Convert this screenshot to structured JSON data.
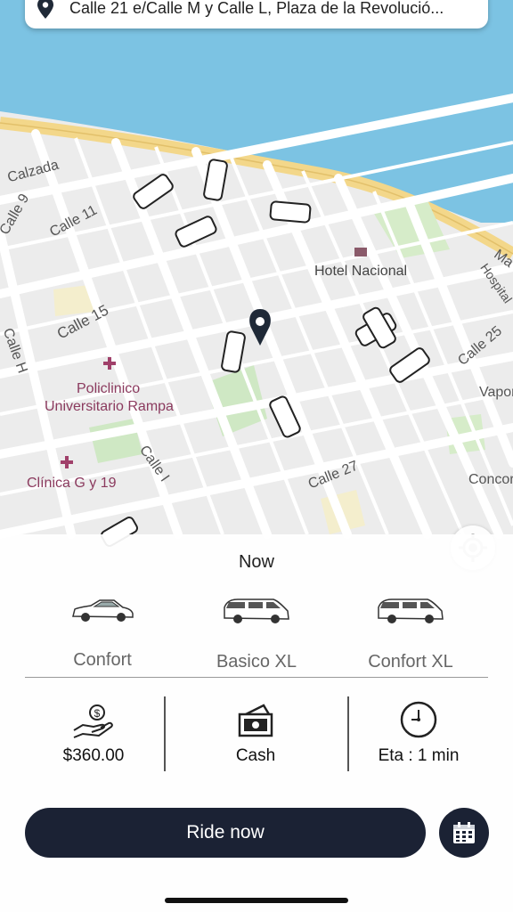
{
  "address": {
    "text": "Calle 21 e/Calle M y Calle L, Plaza de la Revolució..."
  },
  "map": {
    "labels": {
      "calzada": "Calzada",
      "calle9": "Calle 9",
      "calle11": "Calle 11",
      "calle15": "Calle 15",
      "calleH": "Calle H",
      "calleI": "Calle I",
      "calle25": "Calle 25",
      "calle27": "Calle 27",
      "hotel": "Hotel Nacional",
      "policlinico1": "Policlinico",
      "policlinico2": "Universitario Rampa",
      "clinica": "Clínica G y 19",
      "hospital": "Hospital",
      "vapor": "Vapor",
      "concor": "Concor",
      "ma": "Ma"
    }
  },
  "sheet": {
    "now_label": "Now",
    "cars": [
      {
        "label": "Confort"
      },
      {
        "label": "Basico XL"
      },
      {
        "label": "Confort XL"
      }
    ],
    "price": "$360.00",
    "payment": "Cash",
    "eta": "Eta : 1 min",
    "ride_button": "Ride now"
  },
  "colors": {
    "water": "#7cc3e3",
    "coast_road": "#f3d78a",
    "dark_button": "#1b2234",
    "map_bg": "#ececec"
  }
}
